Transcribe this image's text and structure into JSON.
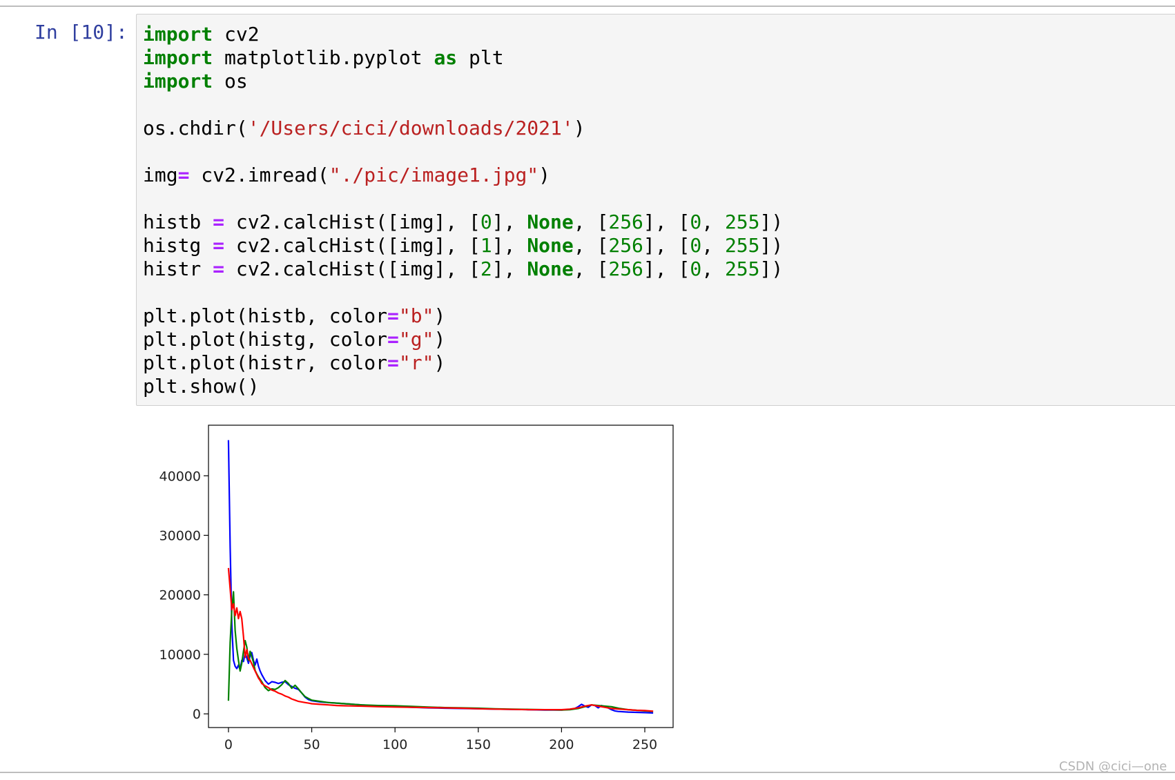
{
  "cell": {
    "prompt": "In [10]:",
    "code_lines": [
      [
        {
          "t": "kw",
          "v": "import"
        },
        {
          "t": "plain",
          "v": " cv2"
        }
      ],
      [
        {
          "t": "kw",
          "v": "import"
        },
        {
          "t": "plain",
          "v": " matplotlib.pyplot "
        },
        {
          "t": "kw",
          "v": "as"
        },
        {
          "t": "plain",
          "v": " plt"
        }
      ],
      [
        {
          "t": "kw",
          "v": "import"
        },
        {
          "t": "plain",
          "v": " os"
        }
      ],
      [],
      [
        {
          "t": "plain",
          "v": "os.chdir("
        },
        {
          "t": "str",
          "v": "'/Users/cici/downloads/2021'"
        },
        {
          "t": "plain",
          "v": ")"
        }
      ],
      [],
      [
        {
          "t": "plain",
          "v": "img"
        },
        {
          "t": "op",
          "v": "="
        },
        {
          "t": "plain",
          "v": " cv2.imread("
        },
        {
          "t": "str",
          "v": "\"./pic/image1.jpg\""
        },
        {
          "t": "plain",
          "v": ")"
        }
      ],
      [],
      [
        {
          "t": "plain",
          "v": "histb "
        },
        {
          "t": "op",
          "v": "="
        },
        {
          "t": "plain",
          "v": " cv2.calcHist([img], ["
        },
        {
          "t": "num",
          "v": "0"
        },
        {
          "t": "plain",
          "v": "], "
        },
        {
          "t": "kw",
          "v": "None"
        },
        {
          "t": "plain",
          "v": ", ["
        },
        {
          "t": "num",
          "v": "256"
        },
        {
          "t": "plain",
          "v": "], ["
        },
        {
          "t": "num",
          "v": "0"
        },
        {
          "t": "plain",
          "v": ", "
        },
        {
          "t": "num",
          "v": "255"
        },
        {
          "t": "plain",
          "v": "])"
        }
      ],
      [
        {
          "t": "plain",
          "v": "histg "
        },
        {
          "t": "op",
          "v": "="
        },
        {
          "t": "plain",
          "v": " cv2.calcHist([img], ["
        },
        {
          "t": "num",
          "v": "1"
        },
        {
          "t": "plain",
          "v": "], "
        },
        {
          "t": "kw",
          "v": "None"
        },
        {
          "t": "plain",
          "v": ", ["
        },
        {
          "t": "num",
          "v": "256"
        },
        {
          "t": "plain",
          "v": "], ["
        },
        {
          "t": "num",
          "v": "0"
        },
        {
          "t": "plain",
          "v": ", "
        },
        {
          "t": "num",
          "v": "255"
        },
        {
          "t": "plain",
          "v": "])"
        }
      ],
      [
        {
          "t": "plain",
          "v": "histr "
        },
        {
          "t": "op",
          "v": "="
        },
        {
          "t": "plain",
          "v": " cv2.calcHist([img], ["
        },
        {
          "t": "num",
          "v": "2"
        },
        {
          "t": "plain",
          "v": "], "
        },
        {
          "t": "kw",
          "v": "None"
        },
        {
          "t": "plain",
          "v": ", ["
        },
        {
          "t": "num",
          "v": "256"
        },
        {
          "t": "plain",
          "v": "], ["
        },
        {
          "t": "num",
          "v": "0"
        },
        {
          "t": "plain",
          "v": ", "
        },
        {
          "t": "num",
          "v": "255"
        },
        {
          "t": "plain",
          "v": "])"
        }
      ],
      [],
      [
        {
          "t": "plain",
          "v": "plt.plot(histb, color"
        },
        {
          "t": "op",
          "v": "="
        },
        {
          "t": "str",
          "v": "\"b\""
        },
        {
          "t": "plain",
          "v": ")"
        }
      ],
      [
        {
          "t": "plain",
          "v": "plt.plot(histg, color"
        },
        {
          "t": "op",
          "v": "="
        },
        {
          "t": "str",
          "v": "\"g\""
        },
        {
          "t": "plain",
          "v": ")"
        }
      ],
      [
        {
          "t": "plain",
          "v": "plt.plot(histr, color"
        },
        {
          "t": "op",
          "v": "="
        },
        {
          "t": "str",
          "v": "\"r\""
        },
        {
          "t": "plain",
          "v": ")"
        }
      ],
      [
        {
          "t": "plain",
          "v": "plt.show()"
        }
      ]
    ]
  },
  "colors": {
    "prompt": "#303f9f",
    "keyword": "#008000",
    "string": "#ba2121",
    "number": "#008000",
    "operator": "#aa22ff",
    "cell_background": "#f5f5f5",
    "cell_border": "#cfcfcf"
  },
  "chart_data": {
    "type": "line",
    "title": "",
    "xlabel": "",
    "ylabel": "",
    "xlim": [
      -12,
      267
    ],
    "ylim": [
      -2300,
      48500
    ],
    "grid": false,
    "legend": "none",
    "xticks": [
      0,
      50,
      100,
      150,
      200,
      250
    ],
    "yticks": [
      0,
      10000,
      20000,
      30000,
      40000
    ],
    "xtick_labels": [
      "0",
      "50",
      "100",
      "150",
      "200",
      "250"
    ],
    "ytick_labels": [
      "0",
      "10000",
      "20000",
      "30000",
      "40000"
    ],
    "series": [
      {
        "color": "#0000ff",
        "x": [
          0,
          1,
          2,
          3,
          4,
          5,
          6,
          7,
          8,
          9,
          10,
          11,
          12,
          13,
          14,
          15,
          16,
          17,
          18,
          19,
          20,
          22,
          24,
          26,
          28,
          30,
          32,
          34,
          36,
          38,
          40,
          42,
          44,
          46,
          48,
          50,
          55,
          60,
          65,
          70,
          80,
          90,
          100,
          110,
          120,
          130,
          140,
          150,
          160,
          170,
          180,
          190,
          200,
          205,
          208,
          210,
          212,
          214,
          216,
          218,
          220,
          222,
          224,
          226,
          228,
          230,
          232,
          234,
          240,
          245,
          250,
          255
        ],
        "y": [
          46000,
          28000,
          15000,
          9000,
          8000,
          7600,
          8200,
          7400,
          9000,
          8800,
          10200,
          9400,
          8500,
          9800,
          10300,
          9000,
          8200,
          9200,
          8000,
          7200,
          6600,
          5600,
          5000,
          5400,
          5300,
          5100,
          5300,
          5400,
          4900,
          4600,
          4300,
          4100,
          3500,
          2800,
          2400,
          2200,
          2000,
          1900,
          1800,
          1700,
          1500,
          1300,
          1200,
          1100,
          1000,
          950,
          900,
          850,
          800,
          750,
          700,
          650,
          650,
          750,
          900,
          1200,
          1600,
          1300,
          1100,
          1500,
          1400,
          1000,
          1400,
          1200,
          1000,
          700,
          500,
          400,
          300,
          250,
          200,
          150
        ]
      },
      {
        "color": "#008000",
        "x": [
          0,
          1,
          2,
          3,
          4,
          5,
          6,
          7,
          8,
          9,
          10,
          11,
          12,
          13,
          14,
          15,
          16,
          17,
          18,
          19,
          20,
          22,
          24,
          26,
          28,
          30,
          32,
          34,
          36,
          38,
          40,
          42,
          44,
          46,
          48,
          50,
          55,
          60,
          65,
          70,
          80,
          90,
          100,
          110,
          120,
          130,
          140,
          150,
          160,
          170,
          180,
          190,
          200,
          205,
          210,
          214,
          218,
          222,
          226,
          230,
          235,
          240,
          245,
          250,
          255
        ],
        "y": [
          2200,
          12000,
          17500,
          20500,
          14000,
          11000,
          9000,
          7200,
          8500,
          10500,
          12300,
          11200,
          9000,
          10500,
          9600,
          8700,
          7300,
          6700,
          6200,
          5800,
          5400,
          4400,
          3900,
          4200,
          4100,
          4400,
          4900,
          5600,
          5100,
          4300,
          4800,
          4200,
          3500,
          2900,
          2600,
          2300,
          2100,
          1900,
          1800,
          1700,
          1500,
          1400,
          1350,
          1250,
          1150,
          1050,
          1000,
          950,
          850,
          800,
          750,
          700,
          650,
          700,
          900,
          1200,
          1500,
          1400,
          1300,
          1200,
          900,
          700,
          600,
          500,
          400
        ]
      },
      {
        "color": "#ff0000",
        "x": [
          0,
          1,
          2,
          3,
          4,
          5,
          6,
          7,
          8,
          9,
          10,
          11,
          12,
          13,
          14,
          15,
          16,
          17,
          18,
          19,
          20,
          22,
          24,
          26,
          28,
          30,
          32,
          34,
          36,
          38,
          40,
          42,
          44,
          46,
          48,
          50,
          55,
          60,
          65,
          70,
          80,
          90,
          100,
          110,
          120,
          130,
          140,
          150,
          160,
          170,
          180,
          190,
          200,
          205,
          210,
          214,
          218,
          222,
          226,
          230,
          235,
          240,
          245,
          250,
          255
        ],
        "y": [
          24500,
          21000,
          17500,
          18500,
          16500,
          17800,
          16000,
          17200,
          16000,
          13000,
          9500,
          10800,
          9300,
          9000,
          8400,
          7800,
          7200,
          6600,
          6000,
          5600,
          5100,
          4700,
          4400,
          4000,
          3800,
          3500,
          3300,
          3000,
          2800,
          2500,
          2300,
          2100,
          2000,
          1900,
          1800,
          1700,
          1600,
          1500,
          1400,
          1350,
          1300,
          1200,
          1150,
          1100,
          1050,
          1000,
          950,
          850,
          800,
          750,
          700,
          700,
          700,
          800,
          1000,
          1300,
          1500,
          1300,
          1100,
          900,
          800,
          700,
          600,
          550,
          450
        ]
      }
    ]
  },
  "footer": {
    "watermark": "CSDN @cici—one"
  }
}
